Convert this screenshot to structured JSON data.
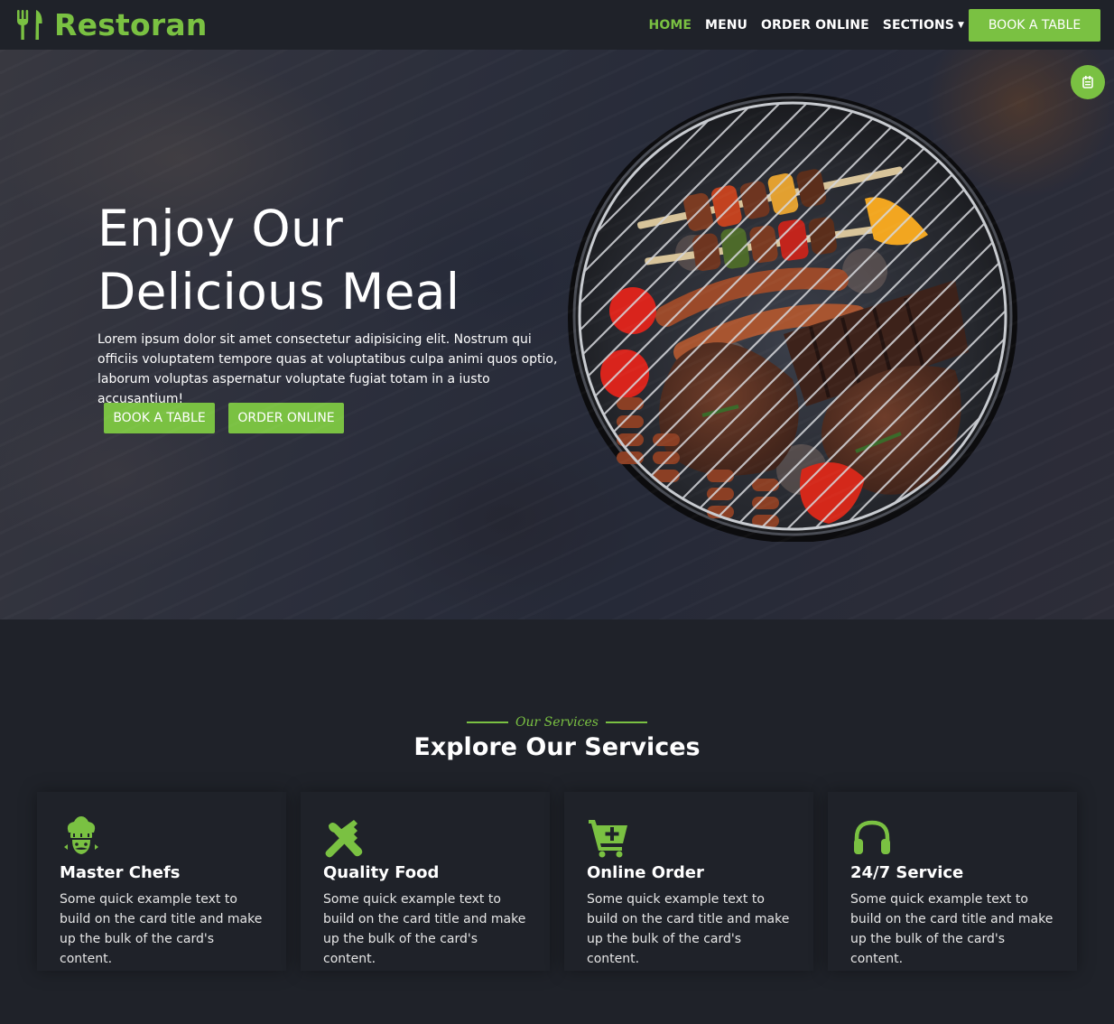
{
  "brand": {
    "name": "Restoran",
    "logo_icon": "utensils-icon",
    "color": "#7ac142"
  },
  "nav": {
    "links": [
      {
        "label": "HOME",
        "active": true
      },
      {
        "label": "MENU",
        "active": false
      },
      {
        "label": "ORDER ONLINE",
        "active": false
      },
      {
        "label": "SECTIONS",
        "active": false,
        "dropdown": true
      }
    ],
    "cta_label": "BOOK A TABLE"
  },
  "hero": {
    "title_line1": "Enjoy Our",
    "title_line2": "Delicious Meal",
    "text": "Lorem ipsum dolor sit amet consectetur adipisicing elit. Nostrum qui officiis voluptatem tempore quas at voluptatibus culpa animi quos optio, laborum voluptas aspernatur voluptate fugiat totam in a iusto accusantium!",
    "book_button": "BOOK A TABLE",
    "order_button": "ORDER ONLINE",
    "image": "bbq-grill-image",
    "float_icon": "calendar-icon"
  },
  "services": {
    "kicker": "Our Services",
    "title": "Explore Our Services",
    "cards": [
      {
        "icon": "chef-hat-icon",
        "title": "Master Chefs",
        "text": "Some quick example text to build on the card title and make up the bulk of the card's content."
      },
      {
        "icon": "utensils-cross-icon",
        "title": "Quality Food",
        "text": "Some quick example text to build on the card title and make up the bulk of the card's content."
      },
      {
        "icon": "cart-plus-icon",
        "title": "Online Order",
        "text": "Some quick example text to build on the card title and make up the bulk of the card's content."
      },
      {
        "icon": "headset-icon",
        "title": "24/7 Service",
        "text": "Some quick example text to build on the card title and make up the bulk of the card's content."
      }
    ]
  },
  "colors": {
    "accent": "#7ac142",
    "background": "#1f2229",
    "hero_overlay": "#2a2d3a"
  }
}
